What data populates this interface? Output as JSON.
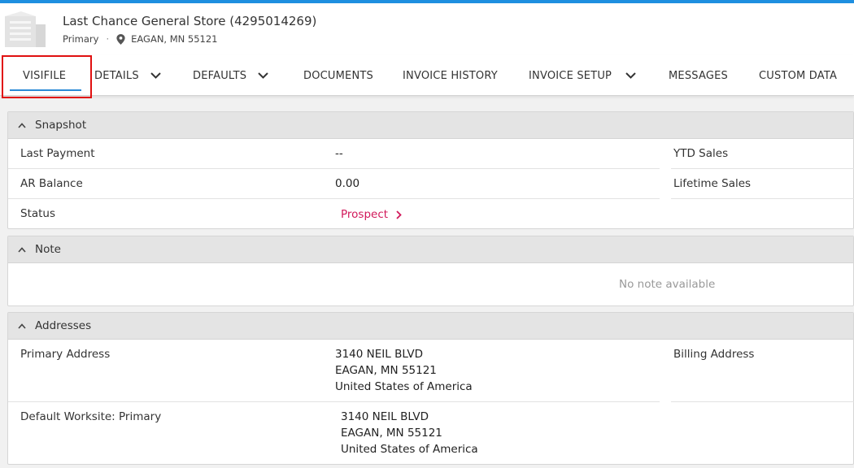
{
  "header": {
    "title": "Last Chance General Store (4295014269)",
    "subtitle_type": "Primary",
    "separator": "·",
    "location": "EAGAN, MN 55121"
  },
  "tabs": [
    {
      "label": "VISIFILE",
      "active": true,
      "dropdown": false
    },
    {
      "label": "DETAILS",
      "active": false,
      "dropdown": true
    },
    {
      "label": "DEFAULTS",
      "active": false,
      "dropdown": true
    },
    {
      "label": "DOCUMENTS",
      "active": false,
      "dropdown": false
    },
    {
      "label": "INVOICE HISTORY",
      "active": false,
      "dropdown": false
    },
    {
      "label": "INVOICE SETUP",
      "active": false,
      "dropdown": true
    },
    {
      "label": "MESSAGES",
      "active": false,
      "dropdown": false
    },
    {
      "label": "CUSTOM DATA",
      "active": false,
      "dropdown": false
    }
  ],
  "snapshot": {
    "title": "Snapshot",
    "last_payment_label": "Last Payment",
    "last_payment_value": "--",
    "ar_balance_label": "AR Balance",
    "ar_balance_value": "0.00",
    "status_label": "Status",
    "status_value": "Prospect",
    "ytd_sales_label": "YTD Sales",
    "lifetime_sales_label": "Lifetime Sales"
  },
  "note": {
    "title": "Note",
    "empty_text": "No note available"
  },
  "addresses": {
    "title": "Addresses",
    "primary_label": "Primary Address",
    "primary_lines": [
      "3140 NEIL BLVD",
      "EAGAN, MN 55121",
      "United States of America"
    ],
    "billing_label": "Billing Address",
    "worksite_label": "Default Worksite: Primary",
    "worksite_lines": [
      "3140 NEIL BLVD",
      "EAGAN, MN 55121",
      "United States of America"
    ]
  },
  "colors": {
    "accent": "#1e8fe0",
    "status_link": "#d1185a",
    "highlight_box": "#e01010"
  },
  "icons": {
    "building": "building-icon",
    "location": "map-pin-icon",
    "tab_dropdown": "chevron-down-icon",
    "panel_toggle": "caret-up-icon",
    "status_link": "chevron-right-icon"
  }
}
